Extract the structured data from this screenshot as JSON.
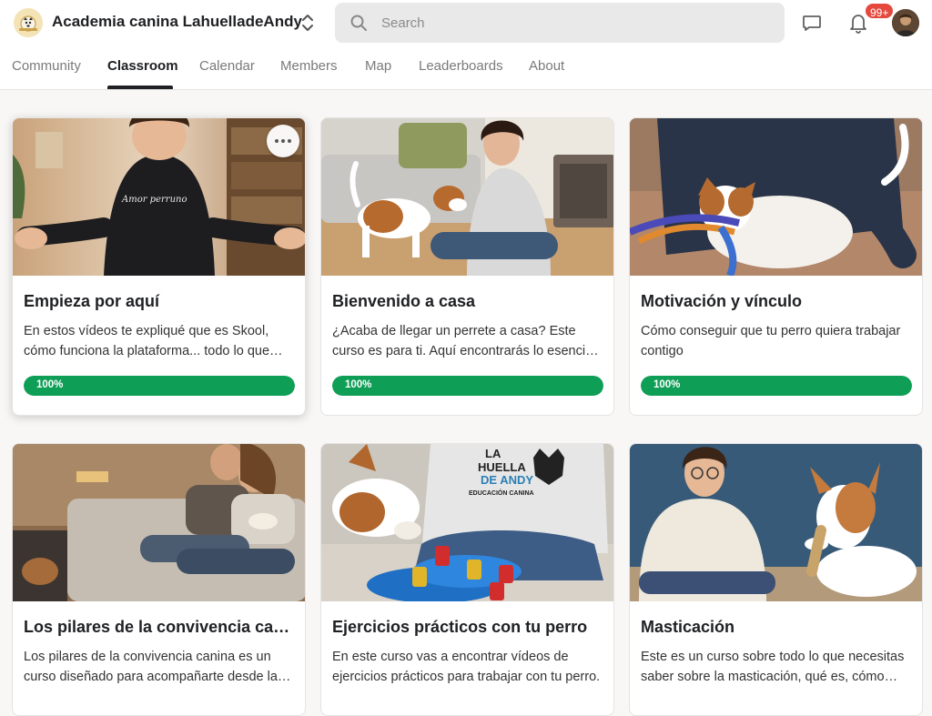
{
  "header": {
    "group_name": "Academia canina LahuelladeAndy",
    "search_placeholder": "Search",
    "notifications_badge": "99+",
    "icons": [
      "group-logo",
      "switcher-icon",
      "search-icon",
      "chat-icon",
      "bell-icon",
      "avatar"
    ]
  },
  "tabs": [
    {
      "label": "Community",
      "active": false
    },
    {
      "label": "Classroom",
      "active": true
    },
    {
      "label": "Calendar",
      "active": false
    },
    {
      "label": "Members",
      "active": false
    },
    {
      "label": "Map",
      "active": false
    },
    {
      "label": "Leaderboards",
      "active": false
    },
    {
      "label": "About",
      "active": false
    }
  ],
  "courses": [
    {
      "title": "Empieza por aquí",
      "description": "En estos vídeos te expliqué que es Skool, cómo funciona la plataforma... todo lo que necesitas saber para empezar.",
      "progress": "100%",
      "progress_value": 1.0,
      "image_text": "Amor perruno"
    },
    {
      "title": "Bienvenido a casa",
      "description": "¿Acaba de llegar un perrete a casa? Este curso es para ti. Aquí encontrarás lo esencial para los primeros días.",
      "progress": "100%",
      "progress_value": 1.0
    },
    {
      "title": "Motivación y vínculo",
      "description": "Cómo conseguir que tu perro quiera trabajar contigo",
      "progress": "100%",
      "progress_value": 1.0
    },
    {
      "title": "Los pilares de la convivencia canina",
      "description": "Los pilares de la convivencia canina es un curso diseñado para acompañarte desde la base."
    },
    {
      "title": "Ejercicios prácticos con tu perro",
      "description": "En este curso vas a encontrar vídeos de ejercicios prácticos para trabajar con tu perro.",
      "image_text": [
        "LA",
        "HUELLA",
        "DE ANDY",
        "EDUCACIÓN CANINA"
      ]
    },
    {
      "title": "Masticación",
      "description": "Este es un curso sobre todo lo que necesitas saber sobre la masticación, qué es, cómo funciona."
    }
  ],
  "colors": {
    "progress_green": "#0f9e56",
    "badge_red": "#e5483d",
    "page_bg": "#f8f7f5"
  }
}
